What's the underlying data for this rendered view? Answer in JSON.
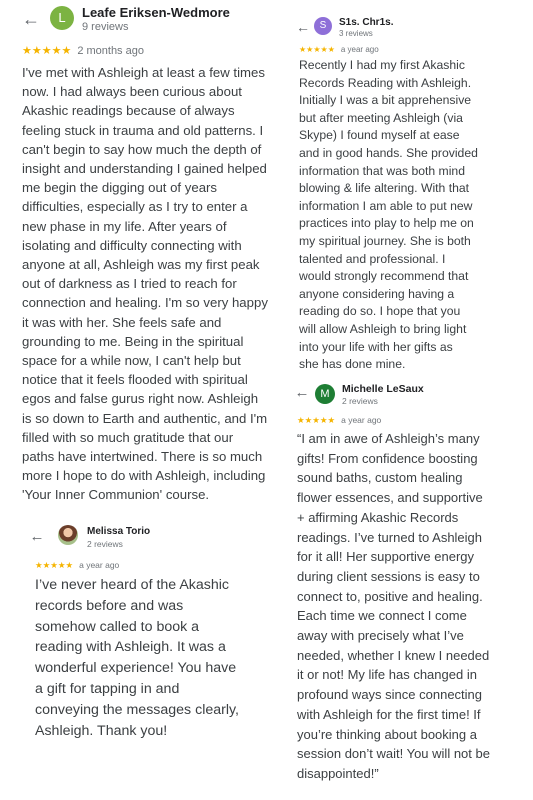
{
  "colors": {
    "star": "#f5b400",
    "name": "#202124",
    "muted": "#70757a",
    "text": "#3c4043"
  },
  "icons": {
    "back": "arrow-left-icon",
    "star": "star-icon"
  },
  "reviews": [
    {
      "avatar_initial": "L",
      "avatar_color": "#7cb342",
      "name": "Leafe Eriksen-Wedmore",
      "review_count": "9 reviews",
      "stars": "★★★★★",
      "time": "2 months ago",
      "text": "I've met with Ashleigh at least a few times\nnow.  I had always been curious about\nAkashic readings because of always\nfeeling stuck in trauma and old patterns.  I\ncan't begin to say how much the depth of\ninsight and understanding I gained helped\nme begin the digging out of years\ndifficulties, especially as I try to enter a\nnew phase in my life.  After years of\nisolating and difficulty connecting with\nanyone at all, Ashleigh was my first peak\nout of darkness as I tried to reach for\nconnection and healing.  I'm so very happy\nit was with her.  She feels safe and\ngrounding to me. Being in the spiritual\nspace for a while now, I can't help but\nnotice that it feels flooded with spiritual\negos and false gurus right now.  Ashleigh\nis so down to Earth and authentic, and I'm\nfilled with so much gratitude that our\npaths have intertwined. There is so much\nmore I hope to do with Ashleigh, including\n'Your Inner Communion' course."
    },
    {
      "avatar_initial": "S",
      "avatar_color": "#8e6fd8",
      "name": "S1s. Chr1s.",
      "review_count": "3 reviews",
      "stars": "★★★★★",
      "time": "a year ago",
      "text": "Recently I had my first Akashic\nRecords Reading with Ashleigh.\nInitially I was a bit apprehensive\nbut after meeting Ashleigh (via\nSkype) I found myself at ease\nand in good hands. She provided\ninformation that was both mind\nblowing & life altering. With that\ninformation I am able to put new\npractices into play to help me on\nmy spiritual journey. She is both\ntalented and professional.  I\nwould strongly recommend that\nanyone considering having a\nreading do so. I hope that you\nwill allow Ashleigh to bring light\ninto your life with her gifts as\nshe has done mine."
    },
    {
      "avatar_initial": "M",
      "avatar_color": "#1e7e34",
      "name": "Michelle LeSaux",
      "review_count": "2 reviews",
      "stars": "★★★★★",
      "time": "a year ago",
      "text": "“I am in awe of Ashleigh’s many\ngifts! From confidence boosting\nsound baths, custom healing\nflower essences, and supportive\n+ affirming Akashic Records\nreadings. I’ve turned to Ashleigh\nfor it all! Her supportive energy\nduring client sessions is easy to\nconnect to, positive and healing.\nEach time we connect I come\naway with precisely what I’ve\nneeded, whether I knew I needed\nit or not! My life has changed in\nprofound ways since connecting\nwith Ashleigh for the first time! If\nyou’re thinking about booking a\nsession don’t wait! You will not be\ndisappointed!”"
    },
    {
      "name": "Melissa Torio",
      "review_count": "2 reviews",
      "stars": "★★★★★",
      "time": "a year ago",
      "text": "I’ve never heard of the Akashic\nrecords before and was\nsomehow called to book a\nreading with Ashleigh. It was a\nwonderful experience! You have\na gift for tapping in and\nconveying the messages clearly,\nAshleigh. Thank you!"
    }
  ]
}
